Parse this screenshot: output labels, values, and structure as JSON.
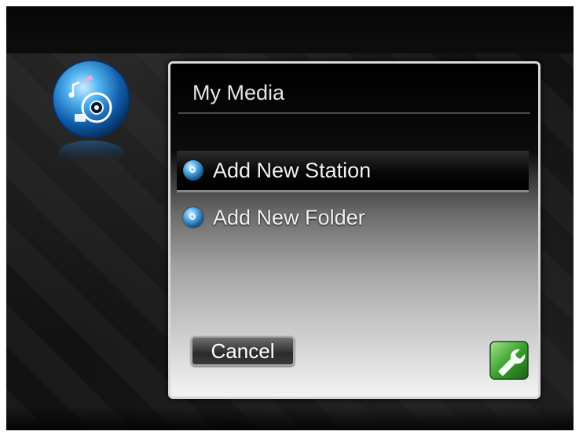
{
  "dialog": {
    "title": "My Media",
    "menu": [
      {
        "label": "Add New Station",
        "icon": "disc-bullet-icon",
        "selected": true
      },
      {
        "label": "Add New Folder",
        "icon": "disc-bullet-icon",
        "selected": false
      }
    ],
    "cancel_label": "Cancel"
  },
  "icons": {
    "app_logo": "media-disc-logo-icon",
    "settings_badge": "wrench-icon"
  },
  "colors": {
    "accent_blue": "#2a86d1",
    "badge_green": "#3aa22b",
    "background": "#151515"
  }
}
